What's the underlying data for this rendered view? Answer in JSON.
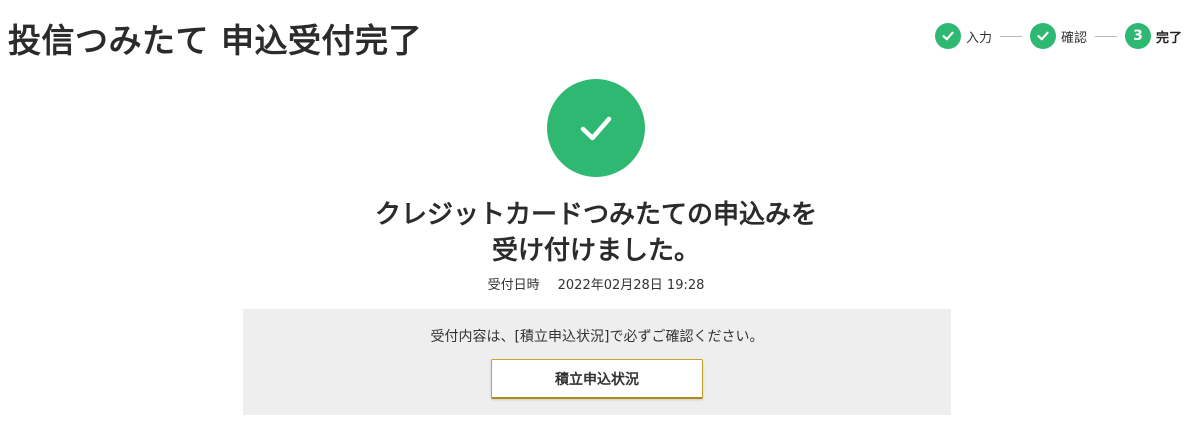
{
  "header": {
    "title": "投信つみたて 申込受付完了"
  },
  "stepper": {
    "steps": [
      {
        "label": "入力",
        "state": "done",
        "icon": "check-icon"
      },
      {
        "label": "確認",
        "state": "done",
        "icon": "check-icon"
      },
      {
        "label": "完了",
        "state": "current",
        "number": "3"
      }
    ],
    "active_color": "#2eb872"
  },
  "success": {
    "icon": "check-icon",
    "color": "#2eb872"
  },
  "message": {
    "line1": "クレジットカードつみたての申込みを",
    "line2": "受け付けました。"
  },
  "accepted": {
    "label": "受付日時",
    "datetime": "2022年02月28日 19:28"
  },
  "info_box": {
    "text": "受付内容は、[積立申込状況]で必ずご確認ください。",
    "button_label": "積立申込状況",
    "background": "#eeeeee",
    "button_border_color": "#c9a32a"
  }
}
